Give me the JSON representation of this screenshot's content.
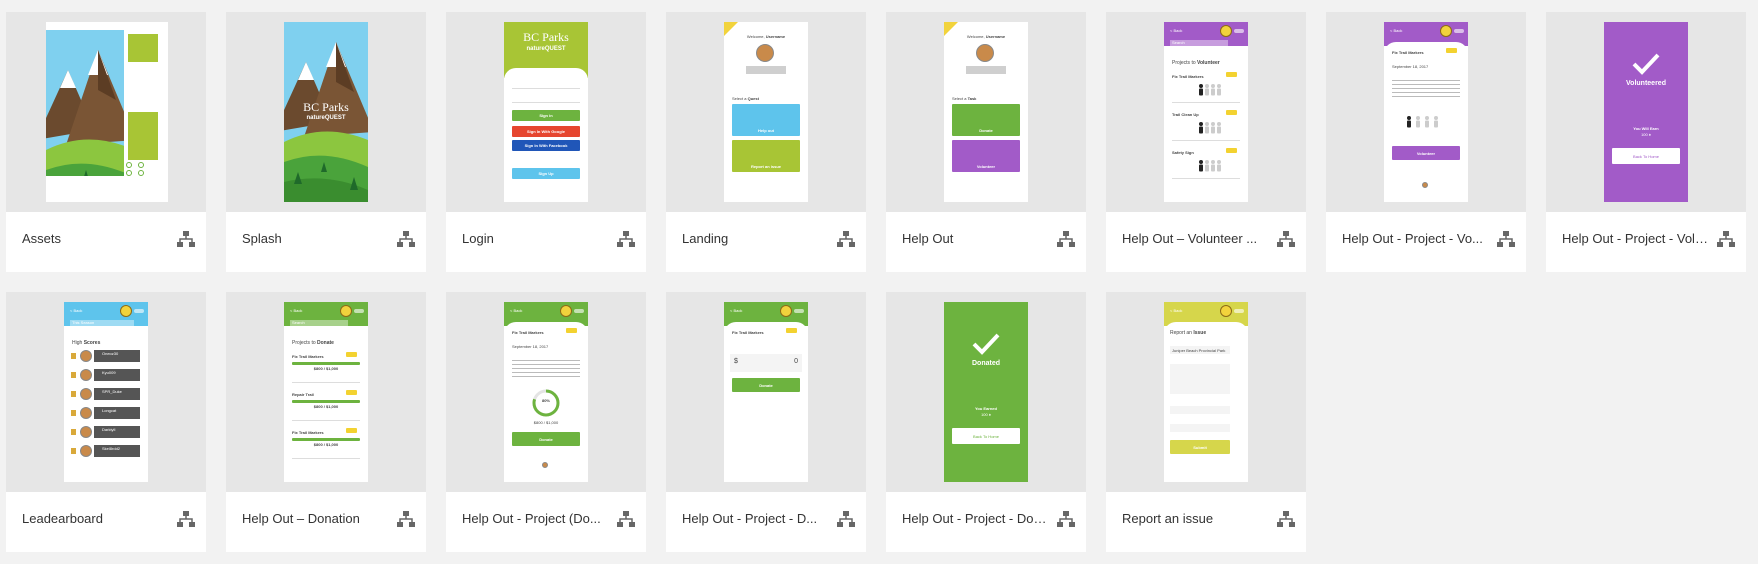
{
  "artboards": [
    {
      "title": "Assets",
      "kind": "assets"
    },
    {
      "title": "Splash",
      "kind": "splash",
      "brand": "BC Parks",
      "sub": "natureQUEST"
    },
    {
      "title": "Login",
      "kind": "login",
      "brand": "BC Parks",
      "sub": "natureQUEST",
      "signin": "Sign in",
      "google": "Sign In With Google",
      "facebook": "Sign In With Facebook",
      "signup": "Sign Up"
    },
    {
      "title": "Landing",
      "kind": "landing",
      "welcome": "Welcome, ",
      "user": "Username",
      "select": "Select a ",
      "selectBold": "Quest",
      "b1": "Help out",
      "b2": "Report an issue"
    },
    {
      "title": "Help Out",
      "kind": "helpout",
      "welcome": "Welcome, ",
      "user": "Username",
      "select": "Select a ",
      "selectBold": "Task",
      "b1": "Donate",
      "b2": "Volunteer"
    },
    {
      "title": "Help Out – Volunteer ...",
      "kind": "vlist",
      "back": "< Back",
      "search": "Search",
      "heading": "Projects to ",
      "headingBold": "Volunteer",
      "items": [
        "Fix Trail Markers",
        "Trail Clean Up",
        "Safety Sign"
      ]
    },
    {
      "title": "Help Out - Project - Vo...",
      "kind": "vproject",
      "back": "< Back",
      "name": "Fix Trail Markers",
      "date": "September 18, 2017",
      "button": "Volunteer"
    },
    {
      "title": "Help Out - Project - Volunteere...",
      "kind": "volunteered",
      "heading": "Volunteered",
      "earn": "You Will Earn",
      "pts": "100 ♦",
      "home": "Back To Home"
    },
    {
      "title": "Leadearboard",
      "kind": "leader",
      "back": "< Back",
      "filter": "This Season",
      "heading": "High ",
      "headingBold": "Scores",
      "names": [
        "Oneoz30",
        "Kyu009",
        "SPR_Duke",
        "Longcat",
        "Darktyll",
        "Skel8rdd2"
      ]
    },
    {
      "title": "Help Out – Donation",
      "kind": "dlist",
      "back": "< Back",
      "search": "Search",
      "heading": "Projects to ",
      "headingBold": "Donate",
      "items": [
        "Fix Trail Markers",
        "Repair Trail",
        "Fix Trail Markers"
      ],
      "amount": "$800 / $1,000"
    },
    {
      "title": "Help Out - Project (Do...",
      "kind": "dproject",
      "back": "< Back",
      "name": "Fix Trail Markers",
      "date": "September 18, 2017",
      "pct": "80%",
      "amount": "$800 / $1,000",
      "button": "Donate"
    },
    {
      "title": "Help Out - Project - D...",
      "kind": "damount",
      "back": "< Back",
      "name": "Fix Trail Markers",
      "dollar": "$",
      "zero": "0",
      "button": "Donate"
    },
    {
      "title": "Help Out - Project - Donated",
      "kind": "donated",
      "heading": "Donated",
      "earn": "You Earned",
      "pts": "100 ♦",
      "home": "Back To Home"
    },
    {
      "title": "Report an issue",
      "kind": "report",
      "back": "< Back",
      "heading": "Report an ",
      "headingBold": "Issue",
      "field": "Juniper Beach Provincial Park",
      "button": "Submit"
    }
  ],
  "colors": {
    "green": "#6db33f",
    "lime": "#a8c535",
    "purple": "#a25bc8",
    "sky": "#5ec4ec",
    "yellow": "#d6d64b",
    "blue": "#2056b8",
    "red": "#e6462f"
  }
}
